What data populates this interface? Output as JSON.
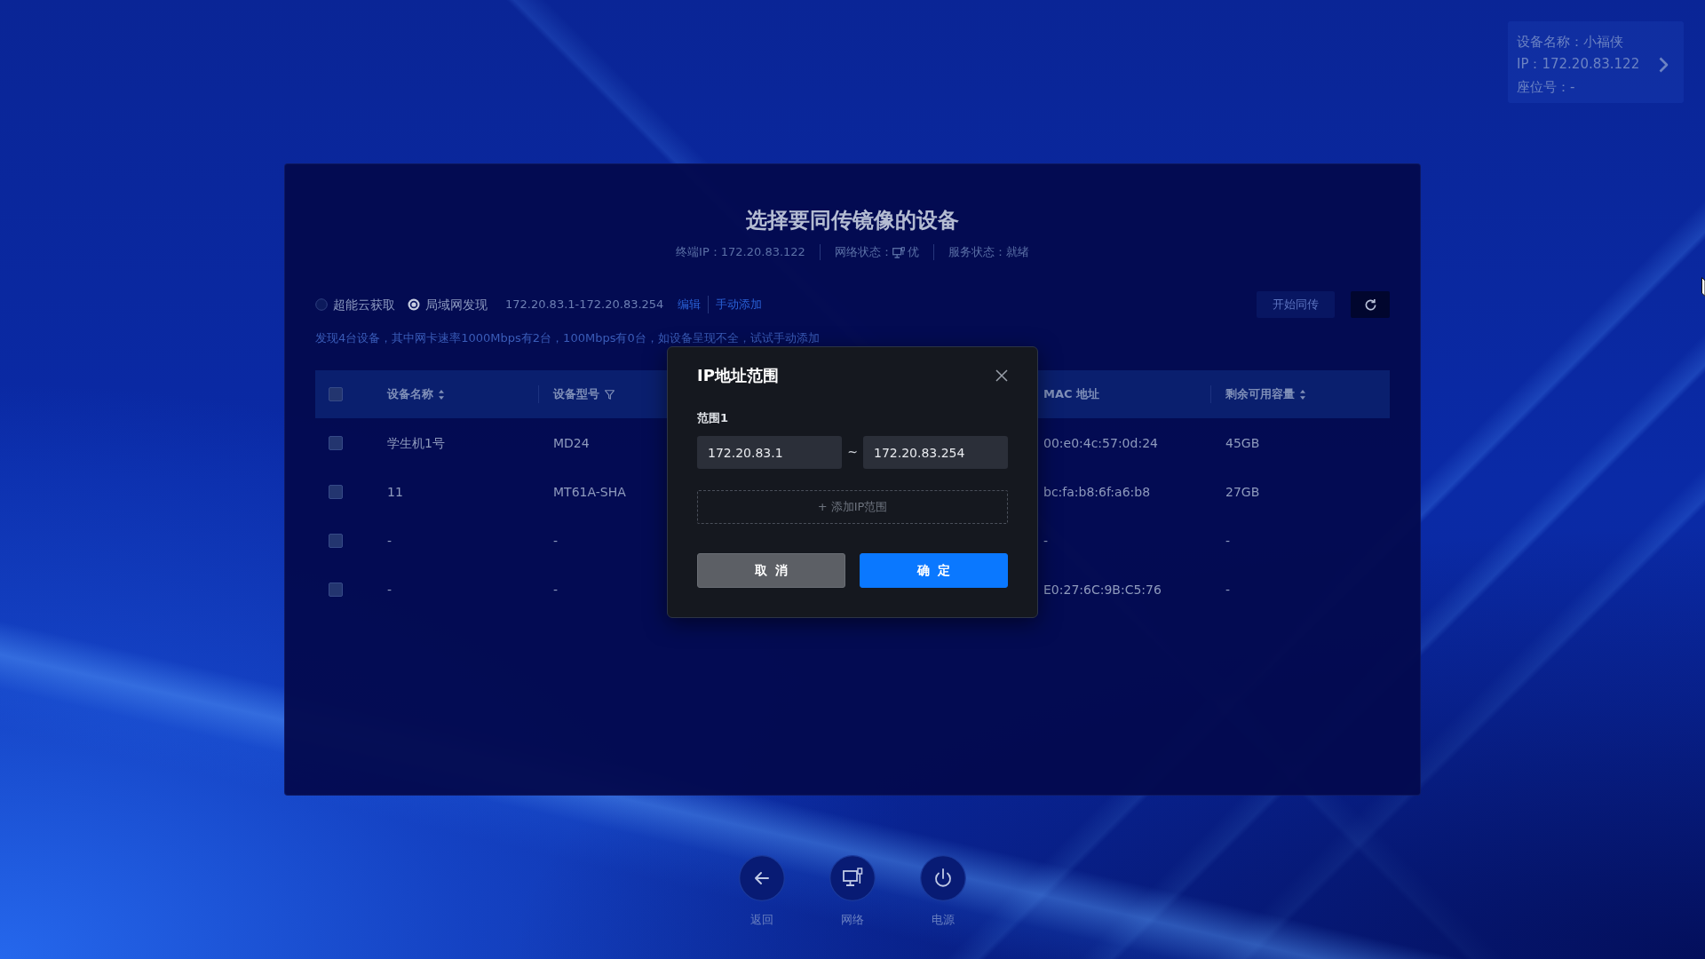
{
  "device_info": {
    "lines": [
      "设备名称：小福侠",
      "IP：172.20.83.122",
      "座位号：-"
    ]
  },
  "panel": {
    "title": "选择要同传镜像的设备",
    "status": [
      {
        "kind": "text",
        "text": "终端IP：172.20.83.122"
      },
      {
        "kind": "network",
        "label": "网络状态：",
        "value": "优"
      },
      {
        "kind": "text",
        "text": "服务状态：就绪"
      }
    ],
    "sources": [
      {
        "label": "超能云获取",
        "selected": false
      },
      {
        "label": "局域网发现",
        "selected": true
      }
    ],
    "ip_range": "172.20.83.1-172.20.83.254",
    "links": [
      "编辑",
      "手动添加"
    ],
    "start_button": {
      "label": "开始同传",
      "disabled": true
    },
    "notice": "发现4台设备，其中网卡速率1000Mbps有2台，100Mbps有0台，如设备呈现不全，试试手动添加",
    "table": {
      "select_all": {
        "checked": false
      },
      "columns": [
        {
          "label": "设备名称",
          "sortable": true,
          "filterable": false
        },
        {
          "label": "设备型号",
          "sortable": false,
          "filterable": true
        },
        {
          "label": "MAC 地址",
          "sortable": false,
          "filterable": false
        },
        {
          "label": "剩余可用容量",
          "sortable": true,
          "filterable": false
        }
      ],
      "rows": [
        {
          "checked": false,
          "cells": [
            "学生机1号",
            "MD24",
            "00:e0:4c:57:0d:24",
            "45GB"
          ]
        },
        {
          "checked": false,
          "cells": [
            "11",
            "MT61A-SHA",
            "bc:fa:b8:6f:a6:b8",
            "27GB"
          ]
        },
        {
          "checked": false,
          "cells": [
            "-",
            "-",
            "-",
            "-"
          ]
        },
        {
          "checked": false,
          "cells": [
            "-",
            "-",
            "E0:27:6C:9B:C5:76",
            "-"
          ]
        }
      ]
    }
  },
  "dialog": {
    "title": "IP地址范围",
    "ranges": [
      {
        "label": "范围1",
        "start": "172.20.83.1",
        "end": "172.20.83.254"
      }
    ],
    "separator": "~",
    "add_button": "+ 添加IP范围",
    "buttons": [
      {
        "kind": "secondary",
        "label": "取消"
      },
      {
        "kind": "primary",
        "label": "确定"
      }
    ]
  },
  "nav": [
    {
      "kind": "back",
      "label": "返回"
    },
    {
      "kind": "network",
      "label": "网络"
    },
    {
      "kind": "power",
      "label": "电源"
    }
  ]
}
